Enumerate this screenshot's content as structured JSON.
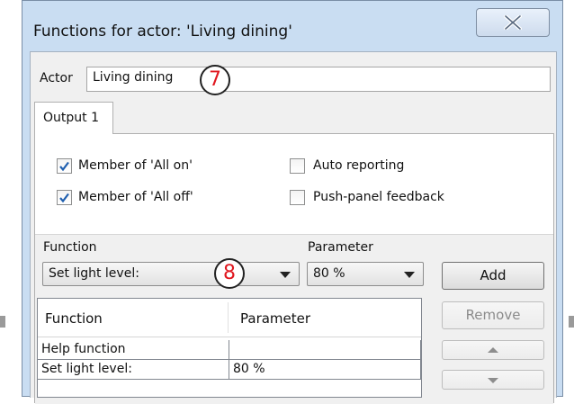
{
  "window": {
    "title": "Functions for actor: 'Living dining'"
  },
  "actor": {
    "label": "Actor",
    "value": "Living dining"
  },
  "callouts": [
    "7",
    "8"
  ],
  "tabs": [
    {
      "label": "Output 1",
      "selected": true
    }
  ],
  "options": {
    "member_all_on": {
      "label": "Member of 'All on'",
      "checked": true
    },
    "member_all_off": {
      "label": "Member of 'All off'",
      "checked": true
    },
    "auto_reporting": {
      "label": "Auto reporting",
      "checked": false
    },
    "push_panel_feedback": {
      "label": "Push-panel feedback",
      "checked": false
    }
  },
  "function_select": {
    "label": "Function",
    "selected": "Set light level:"
  },
  "parameter_select": {
    "label": "Parameter",
    "selected": "80 %"
  },
  "buttons": {
    "add": "Add",
    "remove": "Remove"
  },
  "table": {
    "columns": [
      "Function",
      "Parameter"
    ],
    "rows": [
      [
        "Help function",
        ""
      ],
      [
        "Set light level:",
        "80 %"
      ]
    ]
  },
  "colors": {
    "window_frame": "#c9ddf2",
    "callout_number": "#e0171f",
    "check_mark": "#1f5faf"
  },
  "icons": [
    "close-icon",
    "check-icon",
    "dropdown-arrow-icon",
    "move-up-icon",
    "move-down-icon"
  ]
}
